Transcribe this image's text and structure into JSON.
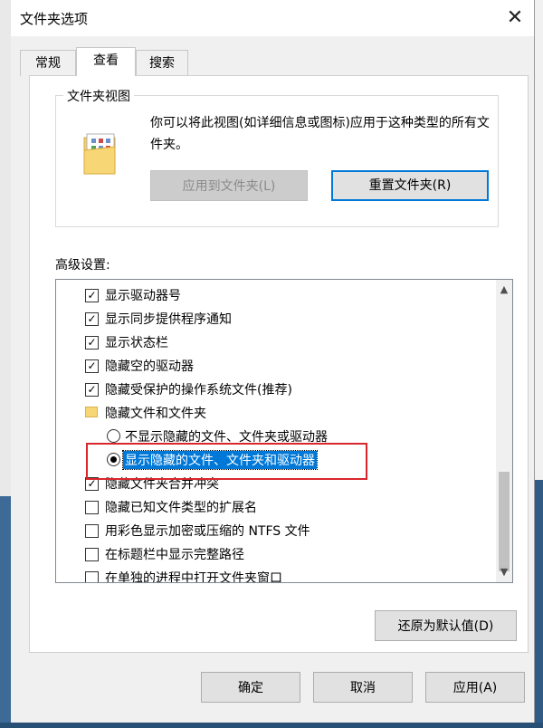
{
  "window": {
    "title": "文件夹选项",
    "close_label": "✕"
  },
  "tabs": [
    {
      "label": "常规"
    },
    {
      "label": "查看"
    },
    {
      "label": "搜索"
    }
  ],
  "folder_views": {
    "group_title": "文件夹视图",
    "description": "你可以将此视图(如详细信息或图标)应用于这种类型的所有文件夹。",
    "apply_button": "应用到文件夹(L)",
    "reset_button": "重置文件夹(R)"
  },
  "advanced": {
    "label": "高级设置:",
    "items": [
      {
        "text": "显示驱动器号",
        "type": "checkbox",
        "checked": true
      },
      {
        "text": "显示同步提供程序通知",
        "type": "checkbox",
        "checked": true
      },
      {
        "text": "显示状态栏",
        "type": "checkbox",
        "checked": true
      },
      {
        "text": "隐藏空的驱动器",
        "type": "checkbox",
        "checked": true
      },
      {
        "text": "隐藏受保护的操作系统文件(推荐)",
        "type": "checkbox",
        "checked": true
      },
      {
        "text": "隐藏文件和文件夹",
        "type": "folder"
      },
      {
        "text": "不显示隐藏的文件、文件夹或驱动器",
        "type": "radio",
        "checked": false
      },
      {
        "text": "显示隐藏的文件、文件夹和驱动器",
        "type": "radio",
        "checked": true,
        "selected": true
      },
      {
        "text": "隐藏文件夹合并冲突",
        "type": "checkbox",
        "checked": true
      },
      {
        "text": "隐藏已知文件类型的扩展名",
        "type": "checkbox",
        "checked": false
      },
      {
        "text": "用彩色显示加密或压缩的 NTFS 文件",
        "type": "checkbox",
        "checked": false
      },
      {
        "text": "在标题栏中显示完整路径",
        "type": "checkbox",
        "checked": false
      },
      {
        "text": "在单独的进程中打开文件夹窗口",
        "type": "checkbox",
        "checked": false
      }
    ],
    "restore_button": "还原为默认值(D)"
  },
  "footer": {
    "ok": "确定",
    "cancel": "取消",
    "apply": "应用(A)"
  },
  "colors": {
    "selection": "#0078d7",
    "annotation": "#d9262b",
    "focus": "#0078d7"
  }
}
